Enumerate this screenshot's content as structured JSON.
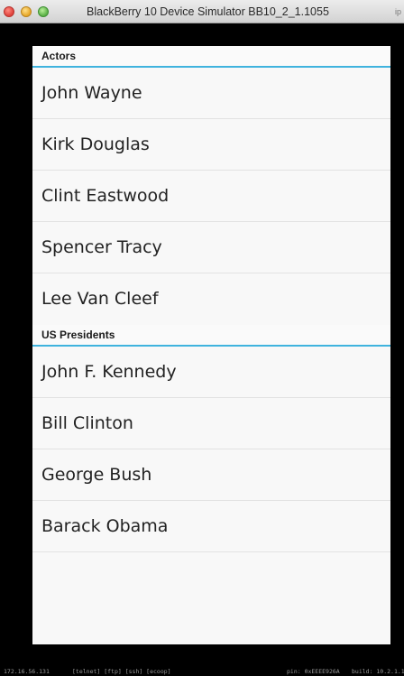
{
  "window": {
    "title": "BlackBerry 10 Device Simulator BB10_2_1.1055",
    "title_tail": "ip"
  },
  "list": {
    "sections": [
      {
        "header": "Actors",
        "items": [
          "John Wayne",
          "Kirk Douglas",
          "Clint Eastwood",
          "Spencer Tracy",
          "Lee Van Cleef"
        ]
      },
      {
        "header": "US Presidents",
        "items": [
          "John F. Kennedy",
          "Bill Clinton",
          "George Bush",
          "Barack Obama"
        ]
      }
    ]
  },
  "statusbar": {
    "ip": "172.16.56.131",
    "services": "[telnet]  [ftp]  [ssh]  [ecoop]",
    "pin": "pin: 0xEEEE926A",
    "build": "build: 10.2.1.1"
  },
  "colors": {
    "accent": "#3fb3de",
    "screen_bg": "#f8f8f8",
    "frame_bg": "#000000"
  }
}
